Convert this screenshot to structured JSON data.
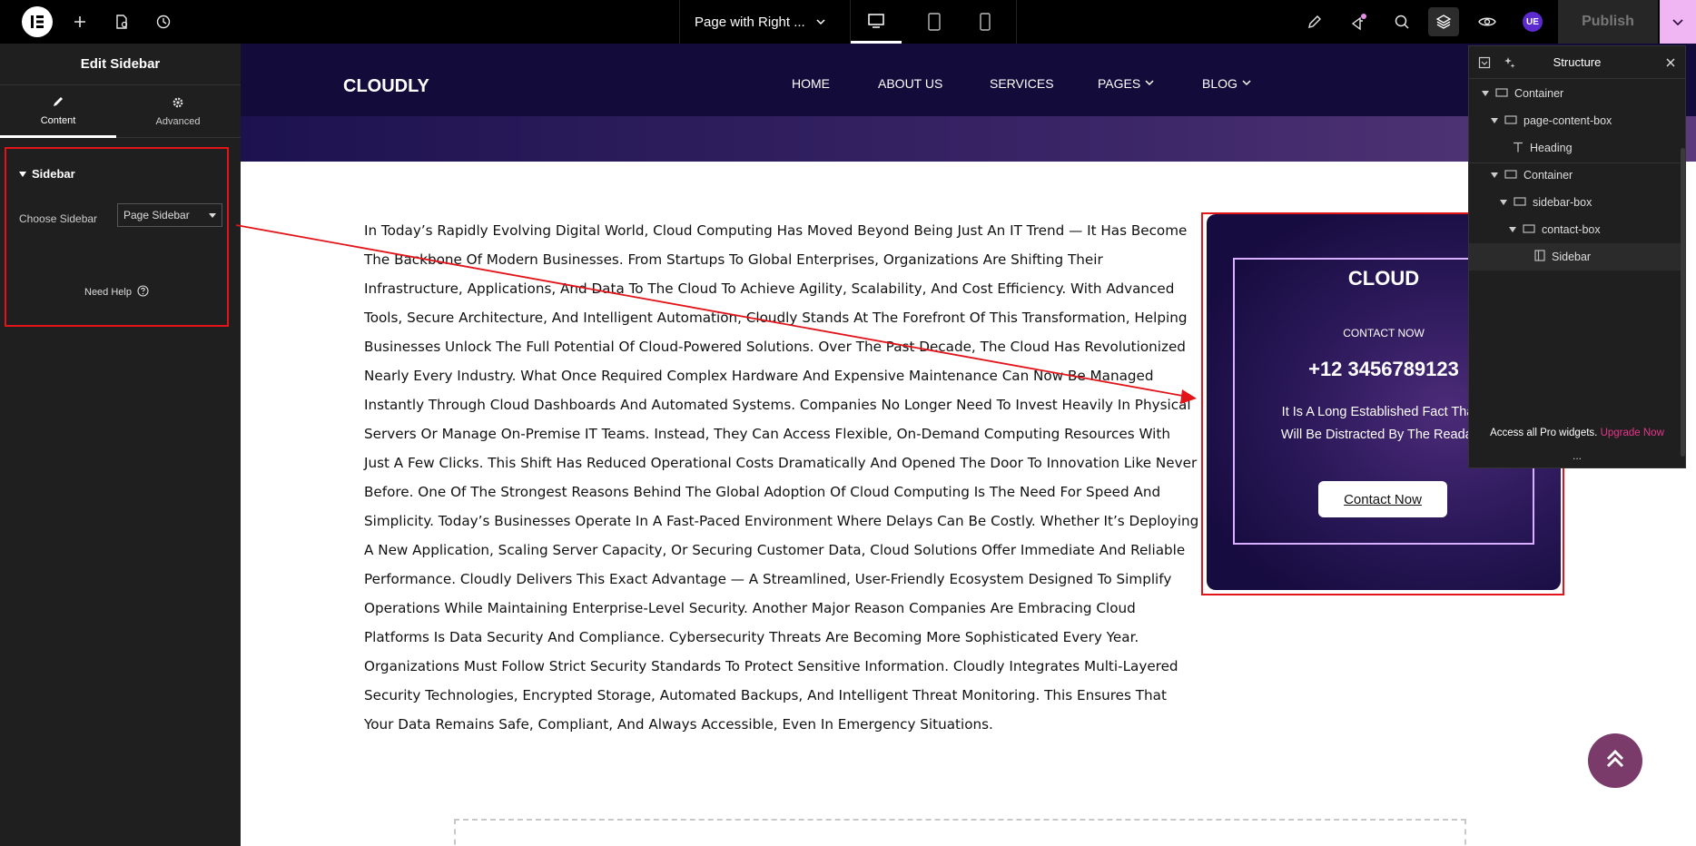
{
  "topbar": {
    "page_name": "Page with Right ...",
    "ue_label": "UE",
    "publish_label": "Publish"
  },
  "left_panel": {
    "title": "Edit Sidebar",
    "tabs": [
      {
        "label": "Content",
        "icon": "pencil-icon"
      },
      {
        "label": "Advanced",
        "icon": "gear-icon"
      }
    ],
    "section_title": "Sidebar",
    "choose_label": "Choose Sidebar",
    "choose_value": "Page Sidebar",
    "need_help": "Need Help"
  },
  "site": {
    "logo": "CLOUDLY",
    "nav": [
      "HOME",
      "ABOUT US",
      "SERVICES",
      "PAGES",
      "BLOG"
    ],
    "body_text": "In Today’s Rapidly Evolving Digital World, Cloud Computing Has Moved Beyond Being Just An IT Trend — It Has Become The Backbone Of Modern Businesses. From Startups To Global Enterprises, Organizations Are Shifting Their Infrastructure, Applications, And Data To The Cloud To Achieve Agility, Scalability, And Cost Efficiency. With Advanced Tools, Secure Architecture, And Intelligent Automation, Cloudly Stands At The Forefront Of This Transformation, Helping Businesses Unlock The Full Potential Of Cloud-Powered Solutions. Over The Past Decade, The Cloud Has Revolutionized Nearly Every Industry. What Once Required Complex Hardware And Expensive Maintenance Can Now Be Managed Instantly Through Cloud Dashboards And Automated Systems. Companies No Longer Need To Invest Heavily In Physical Servers Or Manage On-Premise IT Teams. Instead, They Can Access Flexible, On-Demand Computing Resources With Just A Few Clicks. This Shift Has Reduced Operational Costs Dramatically And Opened The Door To Innovation Like Never Before. One Of The Strongest Reasons Behind The Global Adoption Of Cloud Computing Is The Need For Speed And Simplicity. Today’s Businesses Operate In A Fast-Paced Environment Where Delays Can Be Costly. Whether It’s Deploying A New Application, Scaling Server Capacity, Or Securing Customer Data, Cloud Solutions Offer Immediate And Reliable Performance. Cloudly Delivers This Exact Advantage — A Streamlined, User-Friendly Ecosystem Designed To Simplify Operations While Maintaining Enterprise-Level Security. Another Major Reason Companies Are Embracing Cloud Platforms Is Data Security And Compliance. Cybersecurity Threats Are Becoming More Sophisticated Every Year. Organizations Must Follow Strict Security Standards To Protect Sensitive Information. Cloudly Integrates Multi-Layered Security Technologies, Encrypted Storage, Automated Backups, And Intelligent Threat Monitoring. This Ensures That Your Data Remains Safe, Compliant, And Always Accessible, Even In Emergency Situations.",
    "contact": {
      "title": "CLOUD",
      "subtitle": "CONTACT NOW",
      "phone": "+12 3456789123",
      "desc_line1": "It Is A Long Established Fact That A",
      "desc_line2": "Will Be Distracted By The Readable",
      "button": "Contact Now"
    }
  },
  "structure": {
    "title": "Structure",
    "items": [
      {
        "label": "Container"
      },
      {
        "label": "page-content-box"
      },
      {
        "label": "Heading"
      },
      {
        "label": "Container"
      },
      {
        "label": "sidebar-box"
      },
      {
        "label": "contact-box"
      },
      {
        "label": "Sidebar"
      }
    ],
    "footer_text": "Access all Pro widgets.",
    "footer_link": "Upgrade Now",
    "more": "..."
  },
  "colors": {
    "accent_red": "#e2141a",
    "header_bg": "#130b3a",
    "upgrade_pink": "#e7358b",
    "scroll_btn": "#7a3a6a"
  }
}
